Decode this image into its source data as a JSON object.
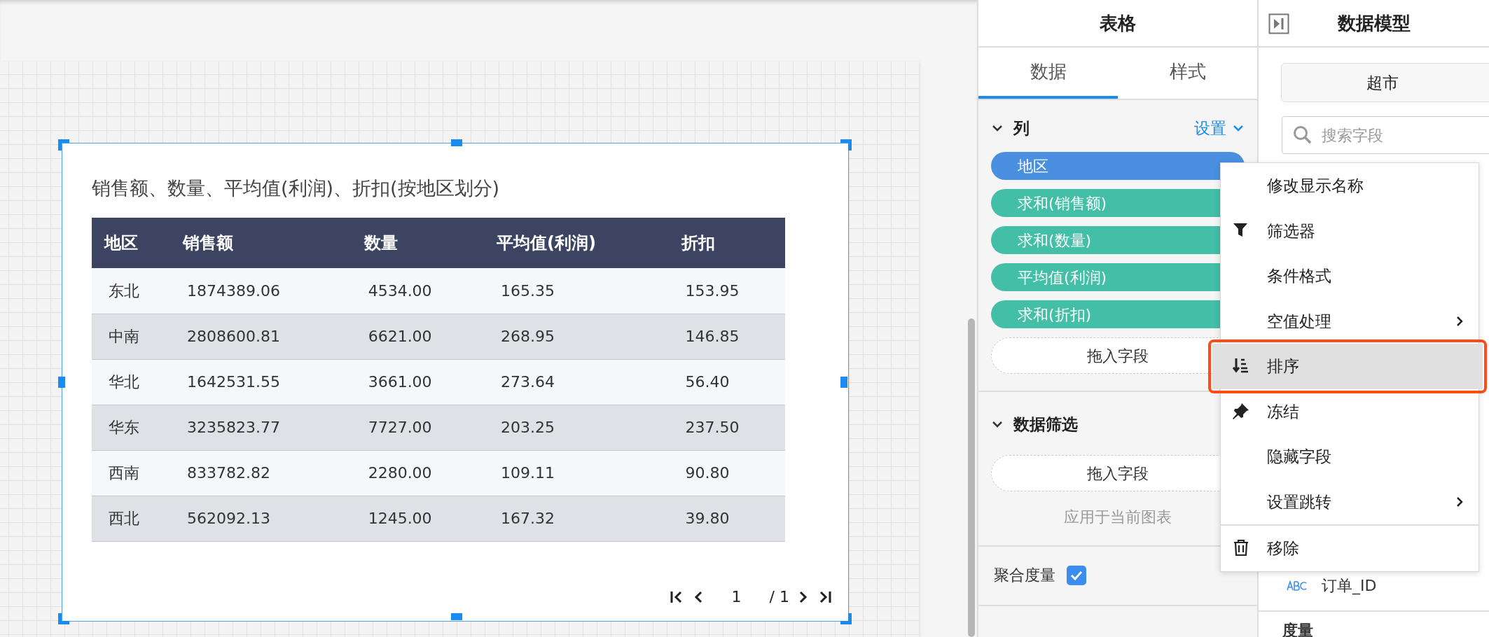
{
  "canvas": {
    "widget": {
      "title": "销售额、数量、平均值(利润)、折扣(按地区划分)",
      "table": {
        "columns": [
          "地区",
          "销售额",
          "数量",
          "平均值(利润)",
          "折扣"
        ],
        "rows": [
          [
            "东北",
            "1874389.06",
            "4534.00",
            "165.35",
            "153.95"
          ],
          [
            "中南",
            "2808600.81",
            "6621.00",
            "268.95",
            "146.85"
          ],
          [
            "华北",
            "1642531.55",
            "3661.00",
            "273.64",
            "56.40"
          ],
          [
            "华东",
            "3235823.77",
            "7727.00",
            "203.25",
            "237.50"
          ],
          [
            "西南",
            "833782.82",
            "2280.00",
            "109.11",
            "90.80"
          ],
          [
            "西北",
            "562092.13",
            "1245.00",
            "167.32",
            "39.80"
          ]
        ]
      },
      "pagination": {
        "page": "1",
        "total": "/ 1"
      }
    }
  },
  "table_panel": {
    "title": "表格",
    "tabs": [
      {
        "label": "数据",
        "selected": true
      },
      {
        "label": "样式",
        "selected": false
      }
    ],
    "columns_section": {
      "title": "列",
      "expanded": true,
      "settings_link": "设置",
      "fields": [
        {
          "label": "地区",
          "kind": "dimension"
        },
        {
          "label": "求和(销售额)",
          "kind": "measure"
        },
        {
          "label": "求和(数量)",
          "kind": "measure"
        },
        {
          "label": "平均值(利润)",
          "kind": "measure"
        },
        {
          "label": "求和(折扣)",
          "kind": "measure"
        }
      ],
      "drop_zone": "拖入字段"
    },
    "filter_section": {
      "title": "数据筛选",
      "expanded": true,
      "drop_zone": "拖入字段",
      "hint": "应用于当前图表"
    },
    "aggregate": {
      "label": "聚合度量",
      "checked": true
    }
  },
  "model_panel": {
    "title": "数据模型",
    "dataset": "超市",
    "search": {
      "placeholder": "搜索字段"
    },
    "fields": [
      {
        "label": "订单_ID",
        "kind": "text"
      }
    ],
    "section": "度量"
  },
  "context_menu": {
    "groups": [
      [
        {
          "label": "修改显示名称",
          "kind": "plain",
          "submenu": false,
          "selected": false
        },
        {
          "label": "筛选器",
          "kind": "filter",
          "submenu": false,
          "selected": false
        },
        {
          "label": "条件格式",
          "kind": "plain",
          "submenu": false,
          "selected": false
        },
        {
          "label": "空值处理",
          "kind": "plain",
          "submenu": true,
          "selected": false
        },
        {
          "label": "排序",
          "kind": "sort",
          "submenu": false,
          "selected": true
        },
        {
          "label": "冻结",
          "kind": "pin",
          "submenu": false,
          "selected": false
        },
        {
          "label": "隐藏字段",
          "kind": "plain",
          "submenu": false,
          "selected": false
        },
        {
          "label": "设置跳转",
          "kind": "plain",
          "submenu": true,
          "selected": false
        }
      ],
      [
        {
          "label": "移除",
          "kind": "remove",
          "submenu": false,
          "selected": false
        }
      ]
    ]
  }
}
